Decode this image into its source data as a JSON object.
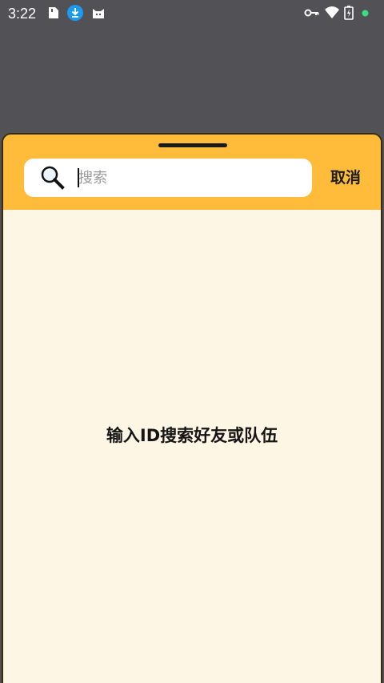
{
  "status_bar": {
    "time": "3:22",
    "left_icons": [
      "sim-card-icon",
      "download-icon",
      "cat-app-icon"
    ],
    "right_icons": [
      "vpn-key-icon",
      "wifi-icon",
      "battery-icon",
      "notification-dot-icon"
    ],
    "download_icon_color": "#1a9bf0",
    "notification_dot_color": "#3ddc84"
  },
  "sheet": {
    "header_color": "#ffbb3a",
    "body_color": "#fef6e4",
    "search": {
      "placeholder": "搜索",
      "value": ""
    },
    "cancel_label": "取消",
    "empty_hint": "输入ID搜索好友或队伍"
  }
}
